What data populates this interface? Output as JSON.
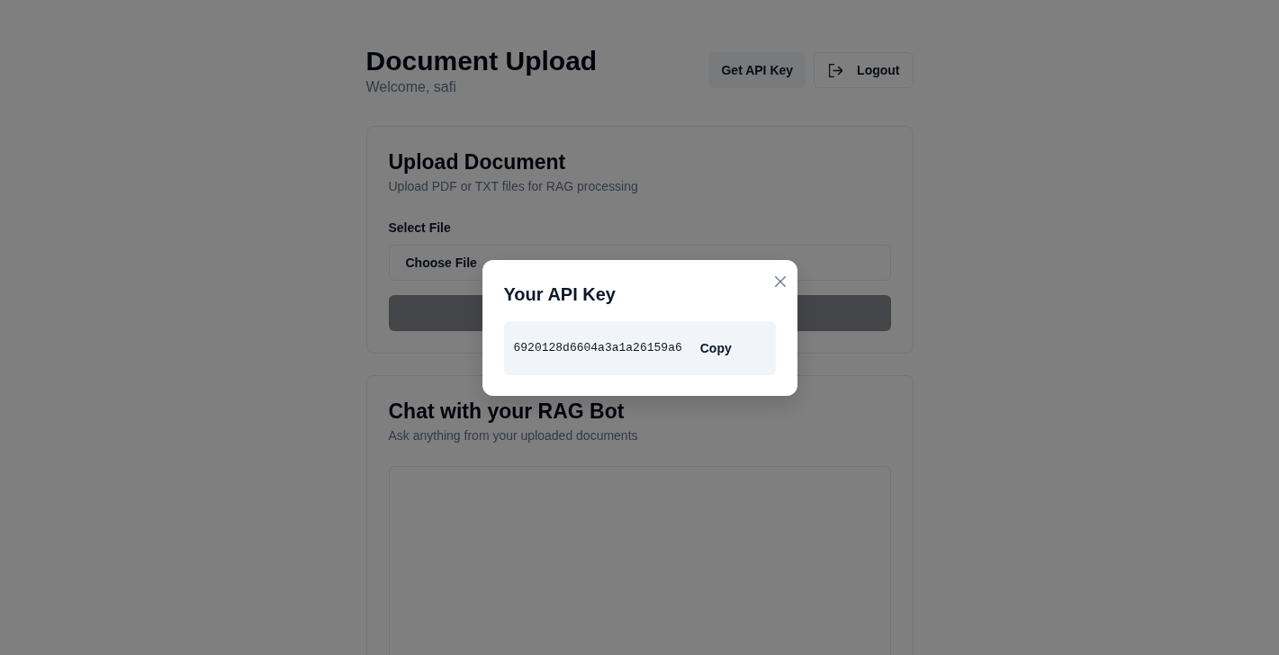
{
  "header": {
    "title": "Document Upload",
    "welcome": "Welcome, safi",
    "buttons": [
      {
        "label": "Get API Key",
        "kind": "secondary"
      },
      {
        "label": "Logout",
        "kind": "outline"
      }
    ]
  },
  "upload_card": {
    "title": "Upload Document",
    "subtitle": "Upload PDF or TXT files for RAG processing",
    "field_label": "Select File",
    "file_input": {
      "button": "Choose File"
    },
    "submit": {
      "disabled": true
    }
  },
  "chat_card": {
    "title": "Chat with your RAG Bot",
    "subtitle": "Ask anything from your uploaded documents"
  },
  "modal": {
    "title": "Your API Key",
    "api_key": "6920128d6604a3a1a26159a6",
    "copy_label": "Copy"
  }
}
